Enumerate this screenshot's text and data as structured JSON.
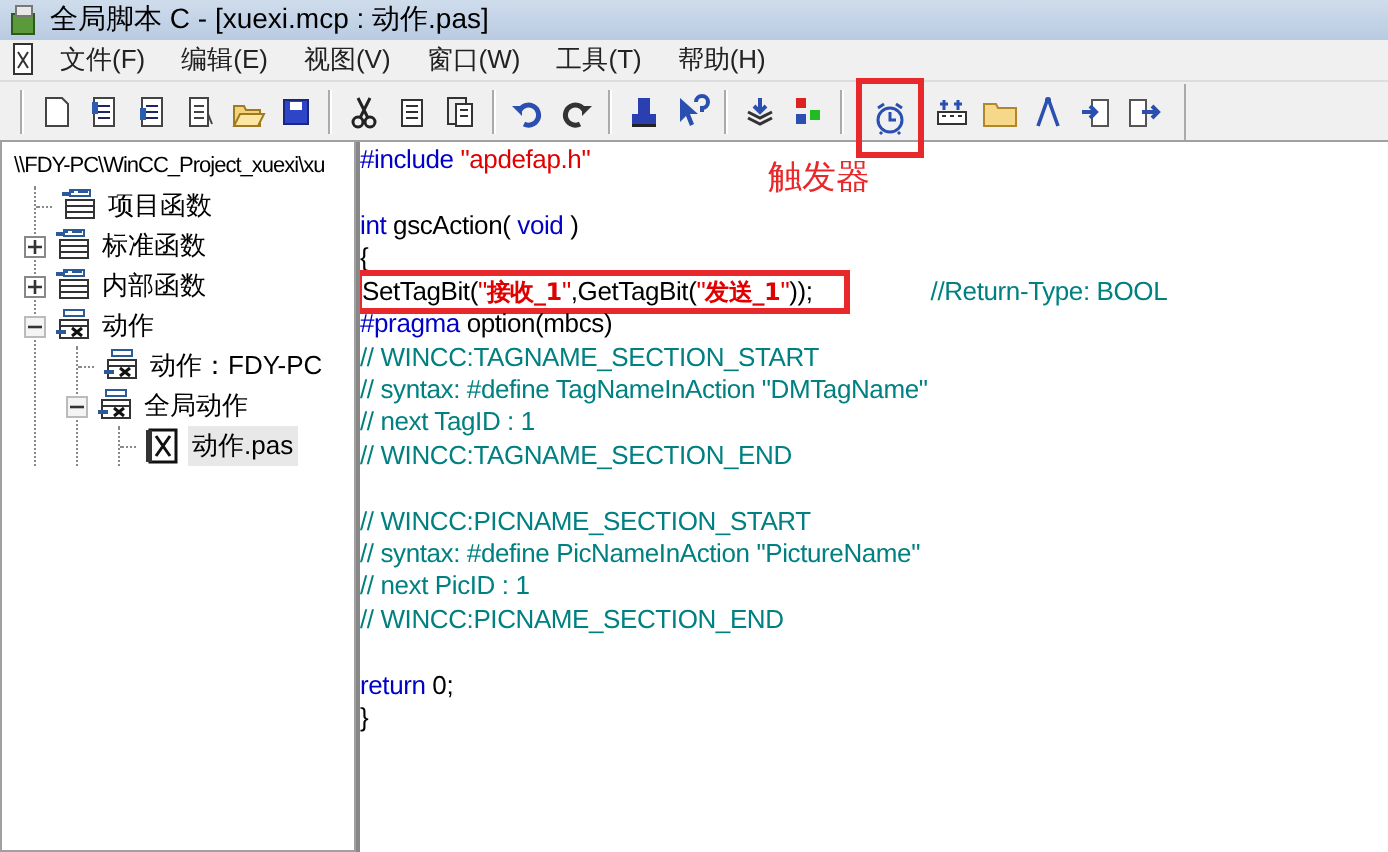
{
  "window": {
    "title": "全局脚本 C - [xuexi.mcp : 动作.pas]"
  },
  "menu": [
    "文件(F)",
    "编辑(E)",
    "视图(V)",
    "窗口(W)",
    "工具(T)",
    "帮助(H)"
  ],
  "toolbar": {
    "annotation": {
      "label": "触发器"
    }
  },
  "tree": {
    "root": "\\\\FDY-PC\\WinCC_Project_xuexi\\xu",
    "items": [
      {
        "label": "项目函数",
        "kind": "folder",
        "selected": false
      },
      {
        "label": "标准函数",
        "kind": "folder",
        "expanded": false,
        "selected": false
      },
      {
        "label": "内部函数",
        "kind": "folder",
        "expanded": false,
        "selected": false
      },
      {
        "label": "动作",
        "kind": "action-folder",
        "expanded": true,
        "selected": false,
        "children": [
          {
            "label": "动作：FDY-PC",
            "kind": "action-folder",
            "selected": false
          },
          {
            "label": "全局动作",
            "kind": "action-folder",
            "expanded": true,
            "selected": false,
            "children": [
              {
                "label": "动作.pas",
                "kind": "file",
                "selected": true
              }
            ]
          }
        ]
      }
    ]
  },
  "editor": {
    "lines": [
      {
        "tokens": [
          {
            "kind": "keyword",
            "text": "#include"
          },
          {
            "kind": "string",
            "text": " \"apdefap.h\""
          }
        ]
      },
      {
        "blank_line_before": true,
        "tokens": [
          {
            "kind": "keyword",
            "text": "int"
          },
          {
            "kind": "plain",
            "text": " gscAction( "
          },
          {
            "kind": "keyword",
            "text": "void"
          },
          {
            "kind": "plain",
            "text": " )"
          }
        ]
      },
      {
        "tokens": [
          {
            "kind": "plain",
            "text": "{"
          }
        ]
      },
      {
        "highlighted": true,
        "tokens": [
          {
            "kind": "plain",
            "text": "SetTagBit("
          },
          {
            "kind": "string",
            "text": "\""
          },
          {
            "kind": "tag",
            "text": "接收_1"
          },
          {
            "kind": "string",
            "text": "\""
          },
          {
            "kind": "plain",
            "text": ",GetTagBit("
          },
          {
            "kind": "string",
            "text": "\""
          },
          {
            "kind": "tag",
            "text": "发送_1"
          },
          {
            "kind": "string",
            "text": "\""
          },
          {
            "kind": "plain",
            "text": "));"
          }
        ],
        "trailing_comment": "//Return-Type: BOOL"
      },
      {
        "tokens": [
          {
            "kind": "keyword",
            "text": "#pragma"
          },
          {
            "kind": "plain",
            "text": " option(mbcs)"
          }
        ]
      },
      {
        "tokens": [
          {
            "kind": "comment",
            "text": "// WINCC:TAGNAME_SECTION_START"
          }
        ]
      },
      {
        "tokens": [
          {
            "kind": "comment",
            "text": "// syntax: #define TagNameInAction \"DMTagName\""
          }
        ]
      },
      {
        "tokens": [
          {
            "kind": "comment",
            "text": "// next TagID : 1"
          }
        ]
      },
      {
        "tokens": [
          {
            "kind": "comment",
            "text": "// WINCC:TAGNAME_SECTION_END"
          }
        ]
      },
      {
        "blank_line_before": true,
        "tokens": [
          {
            "kind": "comment",
            "text": "// WINCC:PICNAME_SECTION_START"
          }
        ]
      },
      {
        "tokens": [
          {
            "kind": "comment",
            "text": "// syntax: #define PicNameInAction \"PictureName\""
          }
        ]
      },
      {
        "tokens": [
          {
            "kind": "comment",
            "text": "// next PicID : 1"
          }
        ]
      },
      {
        "tokens": [
          {
            "kind": "comment",
            "text": "// WINCC:PICNAME_SECTION_END"
          }
        ]
      },
      {
        "blank_line_before": true,
        "tokens": [
          {
            "kind": "keyword",
            "text": "return"
          },
          {
            "kind": "plain",
            "text": " 0;"
          }
        ]
      },
      {
        "tokens": [
          {
            "kind": "plain",
            "text": "}"
          }
        ]
      }
    ]
  }
}
